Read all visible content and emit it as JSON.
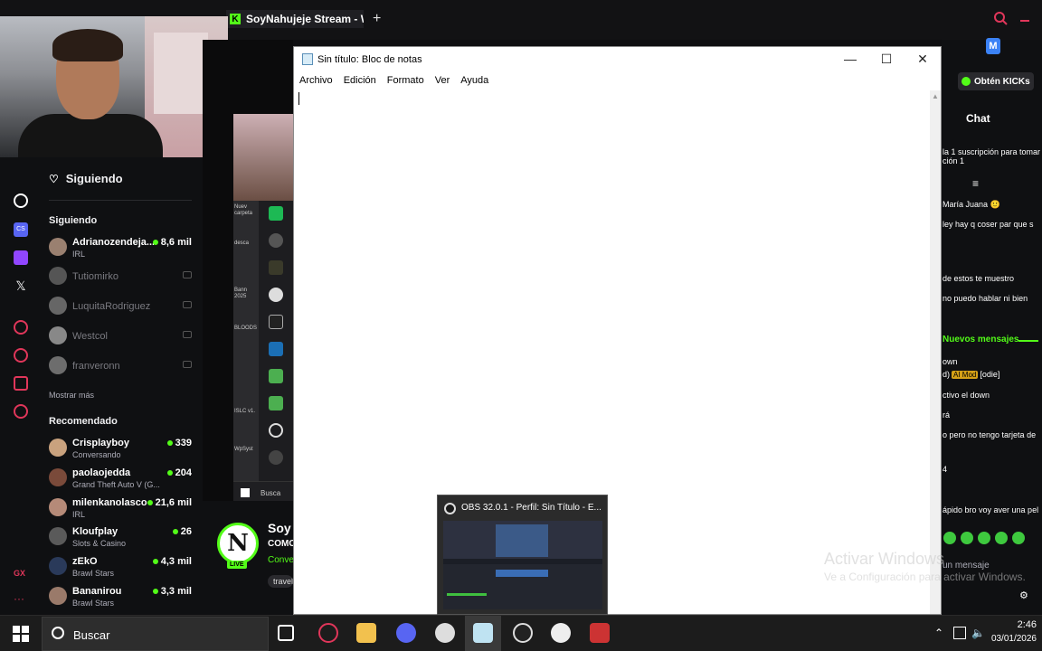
{
  "browser": {
    "active_tab": "SoyNahujeje Stream - Wat",
    "url_fragment": "je"
  },
  "sidebar": {
    "following_header": "Siguiendo",
    "following_section": "Siguiendo",
    "following": [
      {
        "name": "Adrianozendeja...",
        "sub": "IRL",
        "viewers": "8,6 mil",
        "live": true
      },
      {
        "name": "Tutiomirko",
        "live": false
      },
      {
        "name": "LuquitaRodriguez",
        "live": false
      },
      {
        "name": "Westcol",
        "live": false
      },
      {
        "name": "franveronn",
        "live": false
      }
    ],
    "show_more": "Mostrar más",
    "recommended_section": "Recomendado",
    "recommended": [
      {
        "name": "Crisplayboy",
        "sub": "Conversando",
        "viewers": "339"
      },
      {
        "name": "paolaojedda",
        "sub": "Grand Theft Auto V (G...",
        "viewers": "204"
      },
      {
        "name": "milenkanolasco",
        "sub": "IRL",
        "viewers": "21,6 mil"
      },
      {
        "name": "Kloufplay",
        "sub": "Slots & Casino",
        "viewers": "26"
      },
      {
        "name": "zEkO",
        "sub": "Brawl Stars",
        "viewers": "4,3 mil"
      },
      {
        "name": "Bananirou",
        "sub": "Brawl Stars",
        "viewers": "3,3 mil"
      }
    ],
    "rail_badge_cs": "CS",
    "rail_gx": "GX"
  },
  "streamer": {
    "logo_letter": "N",
    "live": "LIVE",
    "name": "Soy",
    "title": "COMC",
    "category": "Conve",
    "tag": "travel"
  },
  "desktop_mini": {
    "label_1": "Nuev carpeta",
    "label_2": "desca",
    "label_3": "Bann 2025",
    "label_4": "BLOODS",
    "label_5": "ISLC v1.",
    "label_6": "WpSyst",
    "search": "Busca"
  },
  "notepad": {
    "title": "Sin título: Bloc de notas",
    "menus": [
      "Archivo",
      "Edición",
      "Formato",
      "Ver",
      "Ayuda"
    ],
    "min": "—",
    "max": "☐",
    "close": "✕"
  },
  "obs_preview": {
    "title": "OBS 32.0.1 - Perfil: Sin Título - E..."
  },
  "chat": {
    "avatar_letter": "M",
    "kicks_button": "Obtén KICKs",
    "title": "Chat",
    "lines": [
      "la 1 suscripción para tomar",
      "ción 1",
      "María Juana 🙂",
      "ley hay q coser par que s",
      "de estos te muestro",
      "no puedo hablar ni bien",
      "own",
      "d)",
      "[odie]",
      "ctivo el down",
      "rá",
      "o pero no tengo tarjeta de",
      "4",
      "ápido bro voy aver una pel"
    ],
    "new_messages": "Nuevos mensajes",
    "ai_mod": "AI Mod",
    "send_placeholder": "un mensaje"
  },
  "watermark": {
    "line1": "Activar Windows",
    "line2": "Ve a Configuración para activar Windows."
  },
  "taskbar": {
    "search": "Buscar",
    "time": "2:46",
    "date": "03/01/2026"
  },
  "colors": {
    "kick_green": "#53fc18",
    "bg_dark": "#0f1012",
    "taskbar": "#1c1c1c"
  }
}
